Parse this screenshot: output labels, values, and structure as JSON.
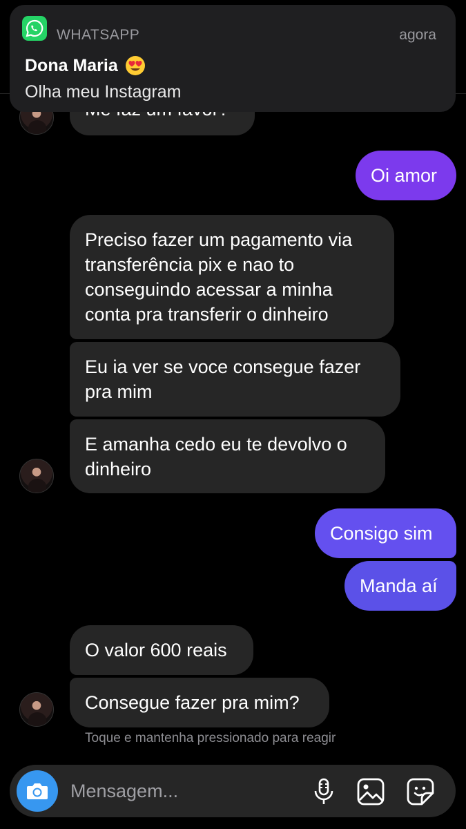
{
  "notification": {
    "app_name": "WHATSAPP",
    "time": "agora",
    "sender": "Dona Maria",
    "sender_emoji": "heart-eyes-emoji",
    "body": "Olha meu Instagram"
  },
  "chat": {
    "partial_message": "Me faz um favor?",
    "messages": [
      {
        "from": "me",
        "lines": [
          "Oi amor"
        ]
      },
      {
        "from": "them",
        "lines": [
          "Preciso fazer um pagamento via",
          "transferência pix e nao to",
          "conseguindo acessar a minha",
          "conta pra transferir o dinheiro"
        ]
      },
      {
        "from": "them",
        "lines": [
          "Eu ia ver se voce consegue fazer",
          "pra mim"
        ]
      },
      {
        "from": "them",
        "lines": [
          "E amanha cedo eu te devolvo o",
          "dinheiro"
        ]
      },
      {
        "from": "me",
        "lines": [
          "Consigo sim"
        ]
      },
      {
        "from": "me",
        "lines": [
          "Manda aí"
        ]
      },
      {
        "from": "them",
        "lines": [
          "O valor 600 reais"
        ]
      },
      {
        "from": "them",
        "lines": [
          "Consegue fazer pra mim?"
        ]
      }
    ],
    "reaction_hint": "Toque e mantenha pressionado para reagir"
  },
  "composer": {
    "placeholder": "Mensagem...",
    "icons": [
      "camera-icon",
      "microphone-icon",
      "gallery-icon",
      "sticker-icon"
    ]
  },
  "colors": {
    "background": "#000000",
    "incoming_bubble": "#262626",
    "outgoing_purple": "#7c3aed",
    "outgoing_indigo": "#5b51e8",
    "camera_blue": "#3797f0",
    "whatsapp_green": "#25d366"
  }
}
